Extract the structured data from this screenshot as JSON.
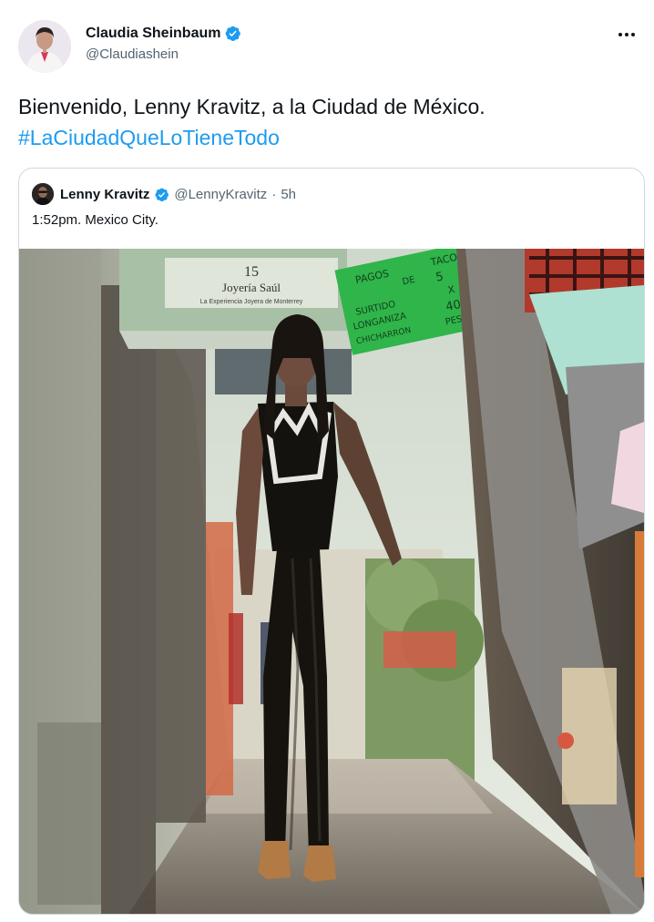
{
  "tweet": {
    "author_name": "Claudia Sheinbaum",
    "author_handle": "@Claudiashein",
    "text_line1": "Bienvenido, Lenny Kravitz, a la Ciudad de México.",
    "hashtag": "#LaCiudadQueLoTieneTodo"
  },
  "quote": {
    "author_name": "Lenny Kravitz",
    "author_handle": "@LennyKravitz",
    "separator": "·",
    "time": "5h",
    "text": "1:52pm. Mexico City."
  },
  "colors": {
    "link": "#1d9bf0",
    "verified": "#1d9bf0",
    "text": "#0f1419",
    "muted": "#536471",
    "border": "#cfd9de"
  },
  "icons": {
    "verified": "verified-badge-icon",
    "more": "more-options-icon"
  },
  "photo_signs": {
    "shop_number": "15",
    "shop_name": "Joyería Saúl",
    "shop_sub": "La Experiencia Joyera de Monterrey",
    "green_sign": [
      "PAGOS",
      "DE",
      "TACOS",
      "5",
      "SURTIDO",
      "X",
      "LONGANIZA",
      "40",
      "CHICHARRON",
      "PESOS"
    ]
  }
}
